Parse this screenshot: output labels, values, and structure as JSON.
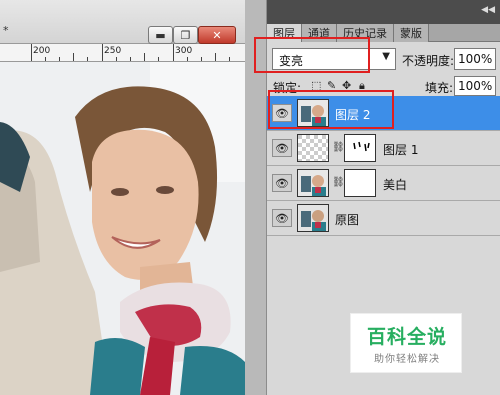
{
  "document": {
    "title_fragment": "*",
    "window_buttons": {
      "minimize": "▬",
      "maximize": "❐",
      "close": "✕"
    },
    "ruler_labels": [
      "200",
      "250",
      "300"
    ]
  },
  "layers_panel": {
    "tabs": [
      "图层",
      "通道",
      "历史记录",
      "蒙版"
    ],
    "blend_mode": "变亮",
    "opacity_label": "不透明度:",
    "opacity_value": "100%",
    "lock_label": "锁定:",
    "fill_label": "填充:",
    "fill_value": "100%",
    "layers": [
      {
        "name": "图层 2",
        "selected": true
      },
      {
        "name": "图层 1",
        "selected": false
      },
      {
        "name": "美白",
        "selected": false
      },
      {
        "name": "原图",
        "selected": false
      }
    ]
  },
  "watermark": {
    "title": "百科全说",
    "subtitle": "助你轻松解决"
  },
  "colors": {
    "selection": "#3d8ee8",
    "annotation": "#e02020",
    "brand_green": "#27ae60"
  }
}
